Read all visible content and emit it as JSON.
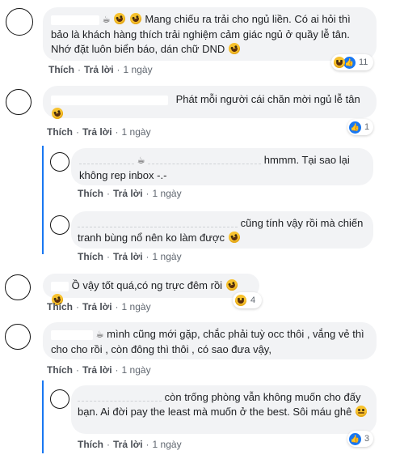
{
  "comments": [
    {
      "text": "Mang chiếu ra trải cho ngủ liền. Có ai hỏi thì bảo là khách hàng thích trải nghiệm cảm giác ngủ ở quầy lễ tân. Nhớ đặt luôn biển báo, dán chữ DND",
      "like": "Thích",
      "reply": "Trả lời",
      "time": "1 ngày",
      "reaction_count": "11"
    },
    {
      "text": "Phát mỗi người cái chăn mời ngủ lễ tân",
      "like": "Thích",
      "reply": "Trả lời",
      "time": "1 ngày",
      "reaction_count": "1"
    },
    {
      "text": "hmmm. Tại sao lại không rep inbox -.-",
      "like": "Thích",
      "reply": "Trả lời",
      "time": "1 ngày"
    },
    {
      "text": "cũng tính vậy rồi mà chiến tranh bùng nổ nên ko làm được",
      "like": "Thích",
      "reply": "Trả lời",
      "time": "1 ngày"
    },
    {
      "text": "Ồ vậy tốt quá,có ng trực đêm rồi",
      "like": "Thích",
      "reply": "Trả lời",
      "time": "1 ngày",
      "reaction_count": "4"
    },
    {
      "text": "mình cũng mới gặp, chắc phải tuỳ occ thôi , vắng vẻ thì cho cho rồi , còn đông thì thôi , có sao đưa vậy,",
      "like": "Thích",
      "reply": "Trả lời",
      "time": "1 ngày"
    },
    {
      "text": "còn trống phòng vẫn không muốn cho đấy bạn. Ai đời pay the least mà muốn ở the best. Sôi máu ghê",
      "like": "Thích",
      "reply": "Trả lời",
      "time": "1 ngày",
      "reaction_count": "3"
    }
  ],
  "colors": {
    "link": "#1877f2",
    "bubble": "#f2f3f5",
    "meta": "#606770"
  },
  "icons": {
    "like": "thumbs-up-icon",
    "haha": "laughing-emoji-icon",
    "cup": "coffee-cup-icon"
  }
}
